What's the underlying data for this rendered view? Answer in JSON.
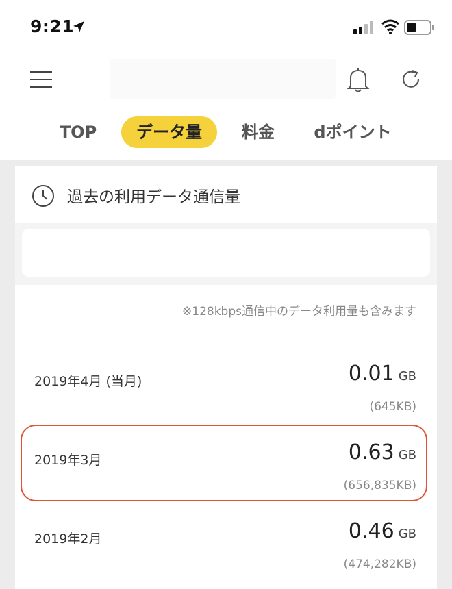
{
  "status_bar": {
    "time": "9:21"
  },
  "tabs": [
    {
      "label": "TOP",
      "active": false
    },
    {
      "label": "データ量",
      "active": true
    },
    {
      "label": "料金",
      "active": false
    },
    {
      "label": "dポイント",
      "active": false
    }
  ],
  "card": {
    "title": "過去の利用データ通信量",
    "note": "※128kbps通信中のデータ利用量も含みます",
    "rows": [
      {
        "month": "2019年4月 (当月)",
        "value": "0.01",
        "unit": "GB",
        "kb": "(645KB)"
      },
      {
        "month": "2019年3月",
        "value": "0.63",
        "unit": "GB",
        "kb": "(656,835KB)",
        "highlighted": true
      },
      {
        "month": "2019年2月",
        "value": "0.46",
        "unit": "GB",
        "kb": "(474,282KB)"
      }
    ]
  },
  "colors": {
    "accent_tab": "#f5d23c",
    "highlight_outline": "#e0553a",
    "background": "#ececec"
  },
  "icons": [
    "location-arrow-icon",
    "signal-icon",
    "wifi-icon",
    "battery-icon",
    "menu-icon",
    "bell-icon",
    "refresh-icon",
    "clock-icon"
  ]
}
